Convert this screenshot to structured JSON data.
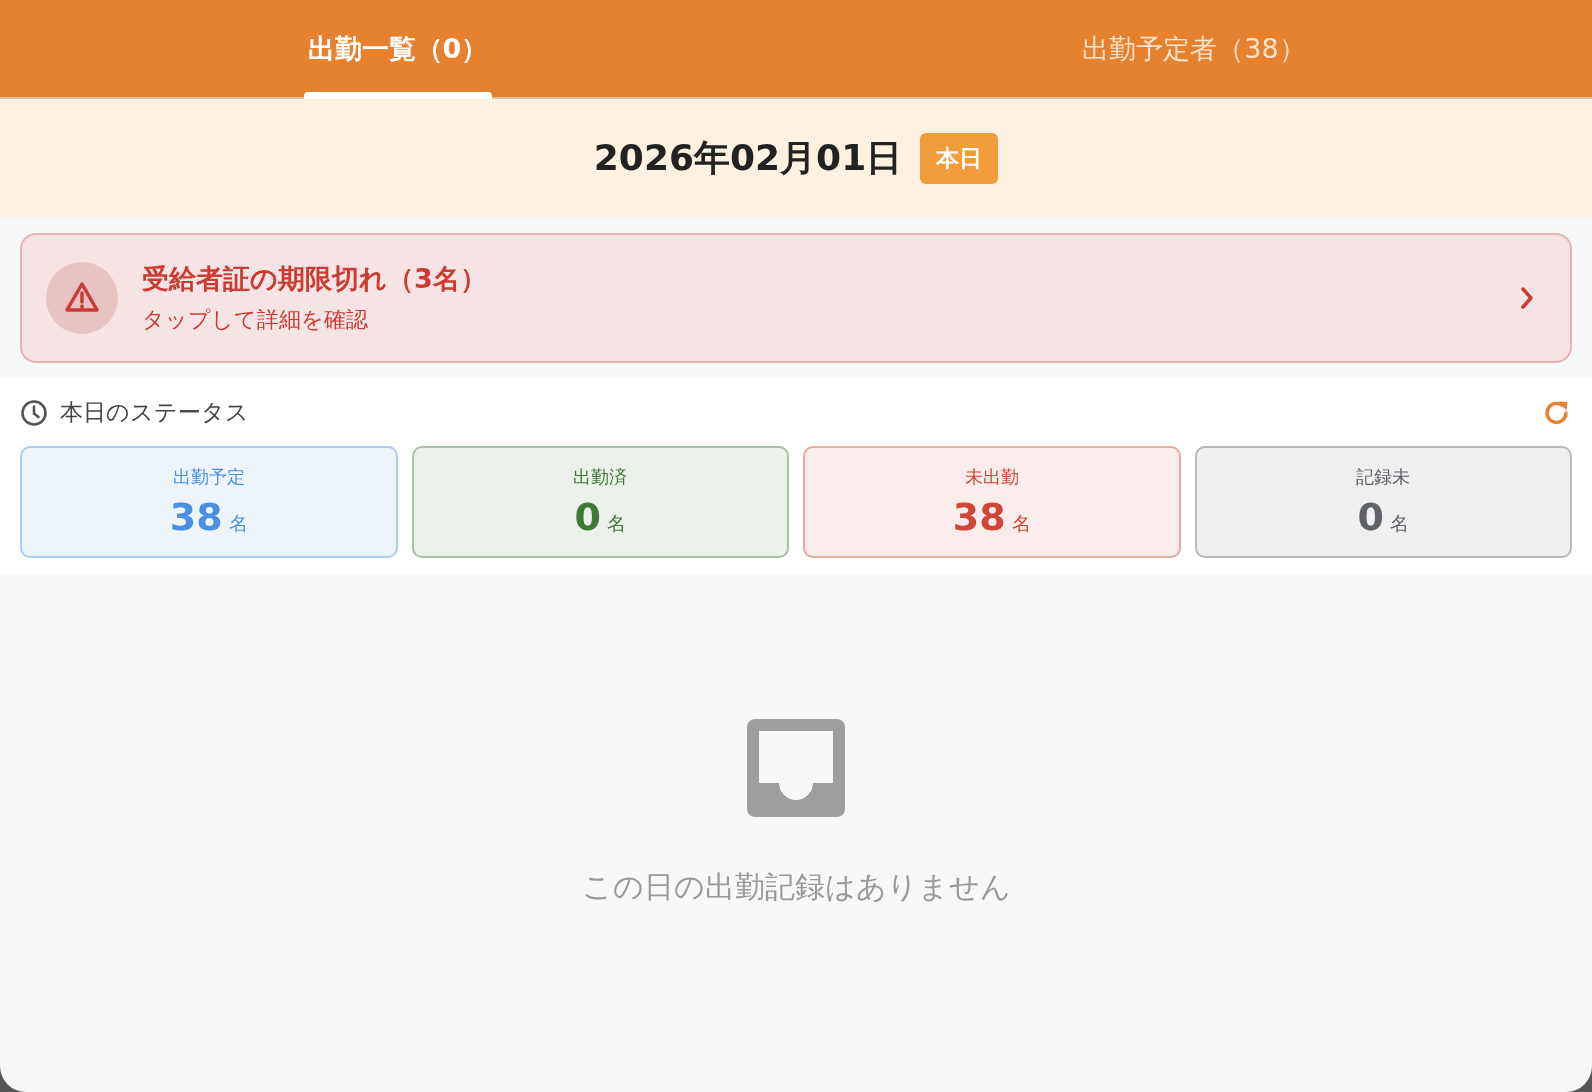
{
  "tabs": [
    {
      "label": "出勤一覧（0）",
      "selected": true
    },
    {
      "label": "出勤予定者（38）",
      "selected": false
    }
  ],
  "date": {
    "text": "2026年02月01日",
    "badge": "本日"
  },
  "alert": {
    "title": "受給者証の期限切れ（3名）",
    "subtitle": "タップして詳細を確認"
  },
  "status": {
    "title": "本日のステータス",
    "cards": [
      {
        "label": "出勤予定",
        "count": "38",
        "unit": "名",
        "color": "#4a90e2"
      },
      {
        "label": "出勤済",
        "count": "0",
        "unit": "名",
        "color": "#3d7a35"
      },
      {
        "label": "未出勤",
        "count": "38",
        "unit": "名",
        "color": "#d0453a"
      },
      {
        "label": "記録未",
        "count": "0",
        "unit": "名",
        "color": "#5f6368"
      }
    ]
  },
  "empty": {
    "message": "この日の出勤記録はありません"
  }
}
